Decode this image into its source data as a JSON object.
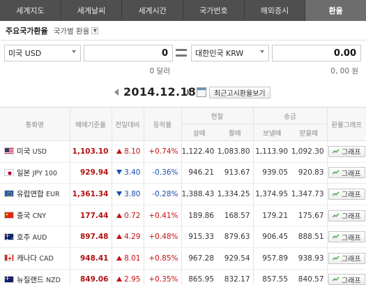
{
  "tabs": [
    "세계지도",
    "세계날씨",
    "세계시간",
    "국가번호",
    "해외증시",
    "환율"
  ],
  "active_tab": 5,
  "subheader": {
    "title": "주요국가환율",
    "selector": "국가별 환율"
  },
  "converter": {
    "from_currency": "미국 USD",
    "from_amount": "0",
    "from_text": "0 달러",
    "to_currency": "대한민국 KRW",
    "to_amount": "0.00",
    "to_text": "0, 00 원"
  },
  "date": "2014.12.18",
  "recent_button": "최근고시환율보기",
  "table": {
    "headers": {
      "currency": "통화명",
      "base_rate": "매매기준율",
      "change": "전일대비",
      "change_rate": "등락율",
      "cash_group": "현찰",
      "remit_group": "송금",
      "graph_col": "환율그래프",
      "cash_buy": "살때",
      "cash_sell": "팔때",
      "send": "보낼때",
      "receive": "받을때"
    },
    "graph_button": "그래프",
    "rows": [
      {
        "name": "미국",
        "code": "USD",
        "flag": "us",
        "base": "1,103.10",
        "dir": "up",
        "change": "8.10",
        "rate": "+0.74%",
        "cash_buy": "1,122.40",
        "cash_sell": "1,083.80",
        "send": "1,113.90",
        "receive": "1,092.30"
      },
      {
        "name": "일본",
        "code": "JPY 100",
        "flag": "jp",
        "base": "929.94",
        "dir": "down",
        "change": "3.40",
        "rate": "-0.36%",
        "cash_buy": "946.21",
        "cash_sell": "913.67",
        "send": "939.05",
        "receive": "920.83"
      },
      {
        "name": "유럽연합",
        "code": "EUR",
        "flag": "eu",
        "base": "1,361.34",
        "dir": "down",
        "change": "3.80",
        "rate": "-0.28%",
        "cash_buy": "1,388.43",
        "cash_sell": "1,334.25",
        "send": "1,374.95",
        "receive": "1,347.73"
      },
      {
        "name": "중국",
        "code": "CNY",
        "flag": "cn",
        "base": "177.44",
        "dir": "up",
        "change": "0.72",
        "rate": "+0.41%",
        "cash_buy": "189.86",
        "cash_sell": "168.57",
        "send": "179.21",
        "receive": "175.67"
      },
      {
        "name": "호주",
        "code": "AUD",
        "flag": "au",
        "base": "897.48",
        "dir": "up",
        "change": "4.29",
        "rate": "+0.48%",
        "cash_buy": "915.33",
        "cash_sell": "879.63",
        "send": "906.45",
        "receive": "888.51"
      },
      {
        "name": "캐나다",
        "code": "CAD",
        "flag": "ca",
        "base": "948.41",
        "dir": "up",
        "change": "8.01",
        "rate": "+0.85%",
        "cash_buy": "967.28",
        "cash_sell": "929.54",
        "send": "957.89",
        "receive": "938.93"
      },
      {
        "name": "뉴질랜드",
        "code": "NZD",
        "flag": "nz",
        "base": "849.06",
        "dir": "up",
        "change": "2.95",
        "rate": "+0.35%",
        "cash_buy": "865.95",
        "cash_sell": "832.17",
        "send": "857.55",
        "receive": "840.57"
      }
    ]
  },
  "colors": {
    "up": "#c81010",
    "down": "#1a4ea8",
    "base": "#b01010",
    "tab_bar": "#4f4f4f",
    "tab_active": "#6d6d6d"
  }
}
